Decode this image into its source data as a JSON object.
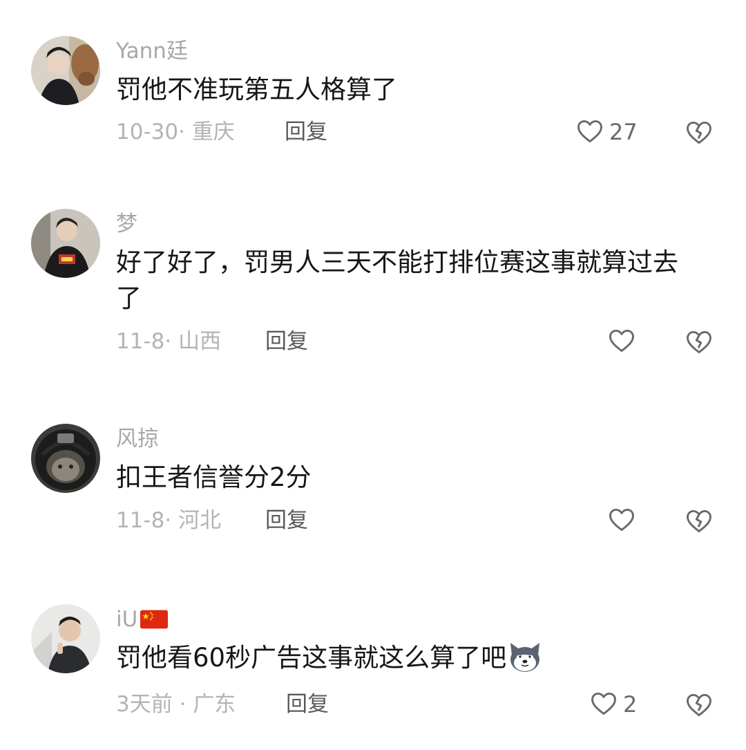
{
  "comments": [
    {
      "username": "Yann廷",
      "text": "罚他不准玩第五人格算了",
      "date": "10-30",
      "sep": "·",
      "location": "重庆",
      "reply_label": "回复",
      "likes": "27"
    },
    {
      "username": "梦",
      "text": "好了好了，罚男人三天不能打排位赛这事就算过去了",
      "date": "11-8",
      "sep": "·",
      "location": "山西",
      "reply_label": "回复",
      "likes": ""
    },
    {
      "username": "风掠",
      "text": "扣王者信誉分2分",
      "date": "11-8",
      "sep": "·",
      "location": "河北",
      "reply_label": "回复",
      "likes": ""
    },
    {
      "username": "iU",
      "text": "罚他看60秒广告这事就这么算了吧",
      "date": "3天前",
      "sep": "·",
      "location": "广东",
      "reply_label": "回复",
      "likes": "2"
    }
  ],
  "icons": {
    "like": "heart-outline-icon",
    "dislike": "broken-heart-icon",
    "flag": "china-flag-icon",
    "emoji": "husky-dog-emoji"
  },
  "colors": {
    "username": "#a8a8a8",
    "text": "#161616",
    "meta": "#b3b3b3",
    "reply": "#5a5a5a",
    "icon": "#6a6a6a"
  }
}
